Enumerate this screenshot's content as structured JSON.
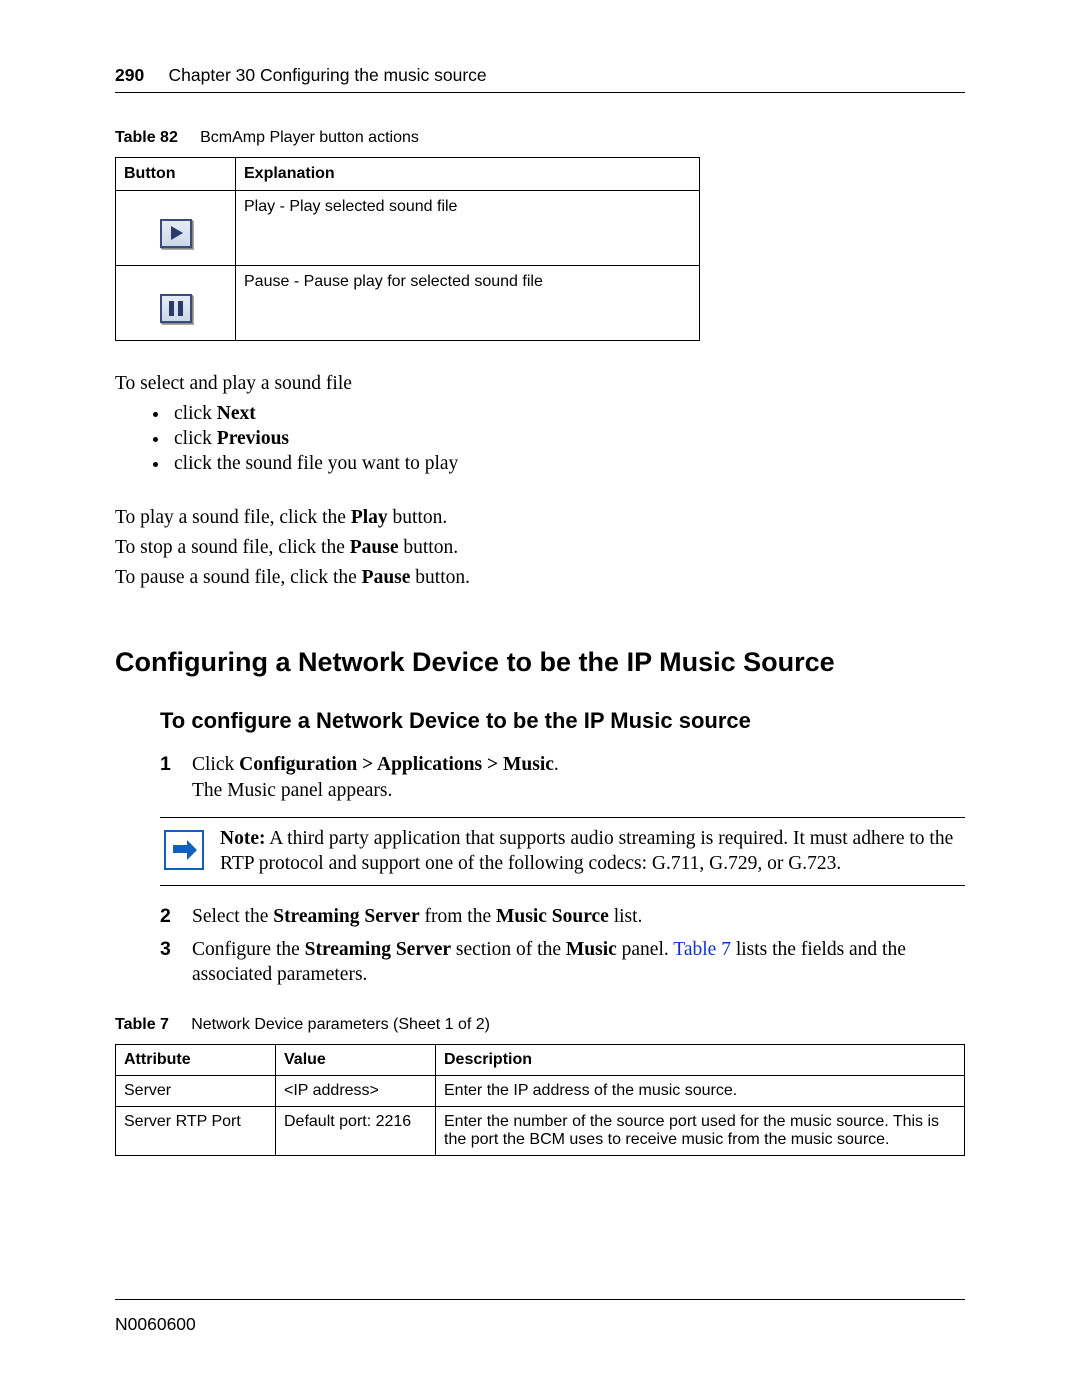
{
  "header": {
    "page_number": "290",
    "chapter_line": "Chapter 30  Configuring the music source"
  },
  "table82": {
    "label": "Table 82",
    "title": "BcmAmp Player button actions",
    "headers": [
      "Button",
      "Explanation"
    ],
    "rows": [
      {
        "explanation": "Play - Play selected sound file"
      },
      {
        "explanation": "Pause - Pause play for selected sound file"
      }
    ]
  },
  "intro_text": "To select and play a sound file",
  "bullets": {
    "b1_prefix": "click ",
    "b1_bold": "Next",
    "b2_prefix": "click ",
    "b2_bold": "Previous",
    "b3": "click the sound file you want to play"
  },
  "paras": {
    "p1a": "To play a sound file, click the ",
    "p1b": "Play",
    "p1c": " button.",
    "p2a": "To stop a sound file, click the ",
    "p2b": "Pause",
    "p2c": " button.",
    "p3a": "To pause a sound file, click the ",
    "p3b": "Pause",
    "p3c": " button."
  },
  "section_heading": "Configuring a Network Device to be the IP Music Source",
  "subsection_heading": "To configure a Network Device to be the IP Music source",
  "step1": {
    "a": "Click ",
    "b": "Configuration > Applications > Music",
    "c": ".",
    "line2": "The Music panel appears."
  },
  "note": {
    "label": "Note:",
    "text": " A third party application that supports audio streaming is required. It must adhere to the RTP protocol and support one of the following codecs: G.711, G.729, or G.723."
  },
  "step2": {
    "a": "Select the ",
    "b": "Streaming Server",
    "c": " from the ",
    "d": "Music Source",
    "e": " list."
  },
  "step3": {
    "a": "Configure the ",
    "b": "Streaming Server",
    "c": " section of the ",
    "d": "Music",
    "e": " panel. ",
    "link": "Table 7",
    "f": " lists the fields and the associated parameters."
  },
  "table7": {
    "label": "Table 7",
    "title": "Network Device parameters (Sheet 1 of 2)",
    "headers": [
      "Attribute",
      "Value",
      "Description"
    ],
    "rows": [
      {
        "attr": "Server",
        "value": "<IP address>",
        "desc": "Enter the IP address of the music source."
      },
      {
        "attr": "Server RTP Port",
        "value": "Default port: 2216",
        "desc": "Enter the number of the source port used for the music source. This is the port the BCM uses to receive music from the music source."
      }
    ]
  },
  "footer": "N0060600"
}
